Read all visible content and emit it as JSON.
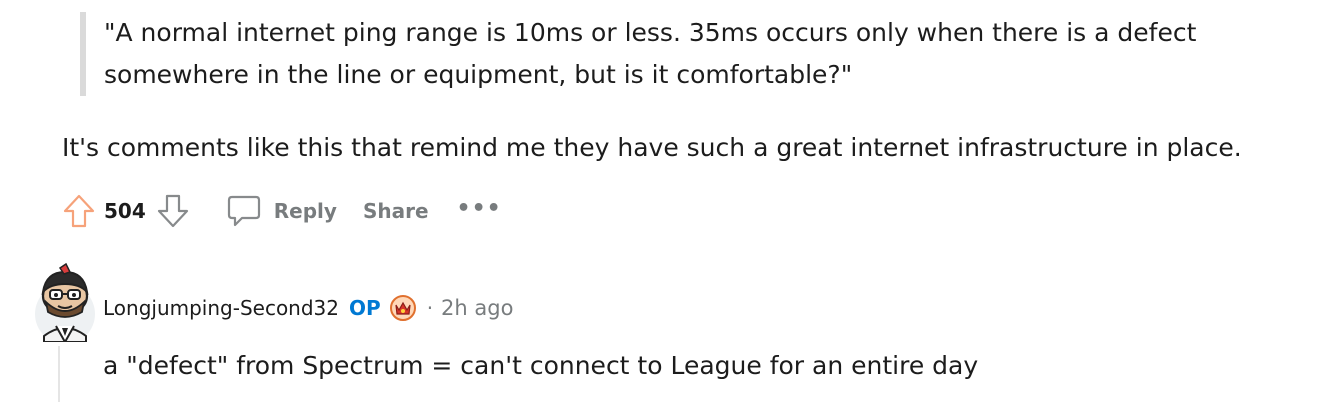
{
  "quote": {
    "line1": "\"A normal internet ping range is 10ms or less. 35ms occurs only when there is a defect",
    "line2": "somewhere in the line or equipment, but is it comfortable?\""
  },
  "comment": {
    "body": "It's comments like this that remind me they have such a great internet infrastructure in place.",
    "score": "504",
    "reply_label": "Reply",
    "share_label": "Share",
    "more_label": "•••"
  },
  "reply": {
    "username": "Longjumping-Second32",
    "op_label": "OP",
    "separator": "·",
    "timestamp": "2h ago",
    "body": "a \"defect\" from Spectrum = can't connect to League for an entire day",
    "avatar_icon": "snoo-avatar-icon",
    "flair_icon": "award-flair-icon"
  },
  "colors": {
    "text": "#1c1c1c",
    "muted": "#787c7e",
    "op_blue": "#0079d3",
    "upvote_orange": "#f6a27a",
    "quote_bar": "#dadada"
  }
}
